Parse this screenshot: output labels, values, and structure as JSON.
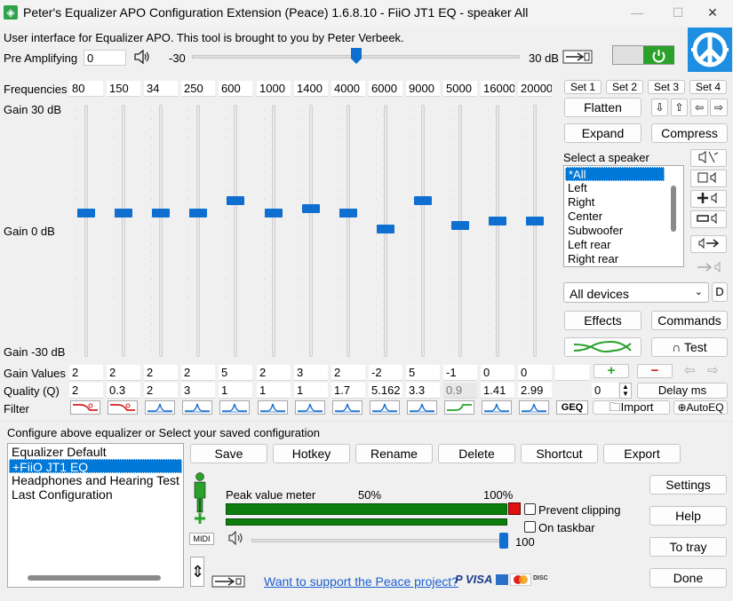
{
  "window": {
    "title": "Peter's Equalizer APO Configuration Extension (Peace) 1.6.8.10 - FiiO JT1 EQ - speaker All",
    "logo_glyph": "◈",
    "minimize": "—",
    "maximize": "☐",
    "close": "✕"
  },
  "header": {
    "intro": "User interface for Equalizer APO. This tool is brought to you by Peter Verbeek.",
    "pre_amp_label": "Pre Amplifying",
    "pre_amp_value": "0",
    "pre_amp_min": "-30",
    "pre_amp_max": "30 dB",
    "pre_amp_level": 0.5,
    "power_state": "on"
  },
  "eq": {
    "frequencies_label": "Frequencies",
    "gain_top_label": "Gain 30 dB",
    "gain_mid_label": "Gain 0 dB",
    "gain_bottom_label": "Gain -30 dB",
    "gain_values_label": "Gain Values",
    "quality_label": "Quality (Q)",
    "filter_label": "Filter",
    "bands": [
      {
        "freq": "80",
        "gain": "2",
        "q": "2",
        "slider": 2,
        "filter": "lowshelf"
      },
      {
        "freq": "150",
        "gain": "2",
        "q": "0.3",
        "slider": 2,
        "filter": "lowshelf"
      },
      {
        "freq": "34",
        "gain": "2",
        "q": "2",
        "slider": 2,
        "filter": "peak"
      },
      {
        "freq": "250",
        "gain": "2",
        "q": "3",
        "slider": 2,
        "filter": "peak"
      },
      {
        "freq": "600",
        "gain": "5",
        "q": "1",
        "slider": 5,
        "filter": "peak"
      },
      {
        "freq": "1000",
        "gain": "2",
        "q": "1",
        "slider": 2,
        "filter": "peak"
      },
      {
        "freq": "1400",
        "gain": "3",
        "q": "1",
        "slider": 3,
        "filter": "peak"
      },
      {
        "freq": "4000",
        "gain": "2",
        "q": "1.7",
        "slider": 2,
        "filter": "peak"
      },
      {
        "freq": "6000",
        "gain": "-2",
        "q": "5.162",
        "slider": -2,
        "filter": "peak"
      },
      {
        "freq": "9000",
        "gain": "5",
        "q": "3.3",
        "slider": 5,
        "filter": "peak"
      },
      {
        "freq": "5000",
        "gain": "-1",
        "q": "0.9",
        "slider": -1,
        "filter": "highshelf"
      },
      {
        "freq": "16000",
        "gain": "0",
        "q": "1.41",
        "slider": 0,
        "filter": "peak"
      },
      {
        "freq": "20000",
        "gain": "0",
        "q": "2.99",
        "slider": 0,
        "filter": "peak"
      }
    ],
    "delay_value": "0"
  },
  "sets": [
    "Set 1",
    "Set 2",
    "Set 3",
    "Set 4"
  ],
  "buttons": {
    "flatten": "Flatten",
    "expand": "Expand",
    "compress": "Compress",
    "effects": "Effects",
    "commands": "Commands",
    "test": "Test",
    "delay_ms": "Delay ms",
    "geq": "GEQ",
    "import": "Import",
    "autoeq": "AutoEQ",
    "d_button": "D"
  },
  "arrows": {
    "down": "⇩",
    "up": "⇧",
    "left": "⇦",
    "right": "⇨",
    "add": "+",
    "remove": "−"
  },
  "speaker": {
    "label": "Select a speaker",
    "items": [
      "*All",
      "Left",
      "Right",
      "Center",
      "Subwoofer",
      "Left rear",
      "Right rear"
    ],
    "selected_index": 0
  },
  "devices": {
    "value": "All devices"
  },
  "config": {
    "label": "Configure above equalizer or Select your saved configuration",
    "items": [
      "Equalizer Default",
      "+FiiO JT1 EQ",
      "Headphones and Hearing Test",
      "Last Configuration"
    ],
    "selected_index": 1,
    "buttons": [
      "Save",
      "Hotkey",
      "Rename",
      "Delete",
      "Shortcut",
      "Export"
    ]
  },
  "meter": {
    "label": "Peak value meter",
    "mark_50": "50%",
    "mark_100": "100%",
    "prevent_clipping": "Prevent clipping",
    "on_taskbar": "On taskbar",
    "volume": "100",
    "volume_level": 1.0,
    "midi": "MIDI"
  },
  "side_buttons": [
    "Settings",
    "Help",
    "To tray",
    "Done"
  ],
  "support": {
    "link": "Want to support the Peace project?",
    "payments": [
      "PayPal",
      "VISA",
      "Amex",
      "MasterCard",
      "Discover"
    ]
  },
  "colors": {
    "accent": "#0078d7",
    "slider_thumb": "#0f6fd0",
    "meter_green": "#0d7d0d",
    "clip_red": "#e01010",
    "power_green": "#2aa12a",
    "add_green": "#2aa12a",
    "remove_red": "#d02020"
  }
}
